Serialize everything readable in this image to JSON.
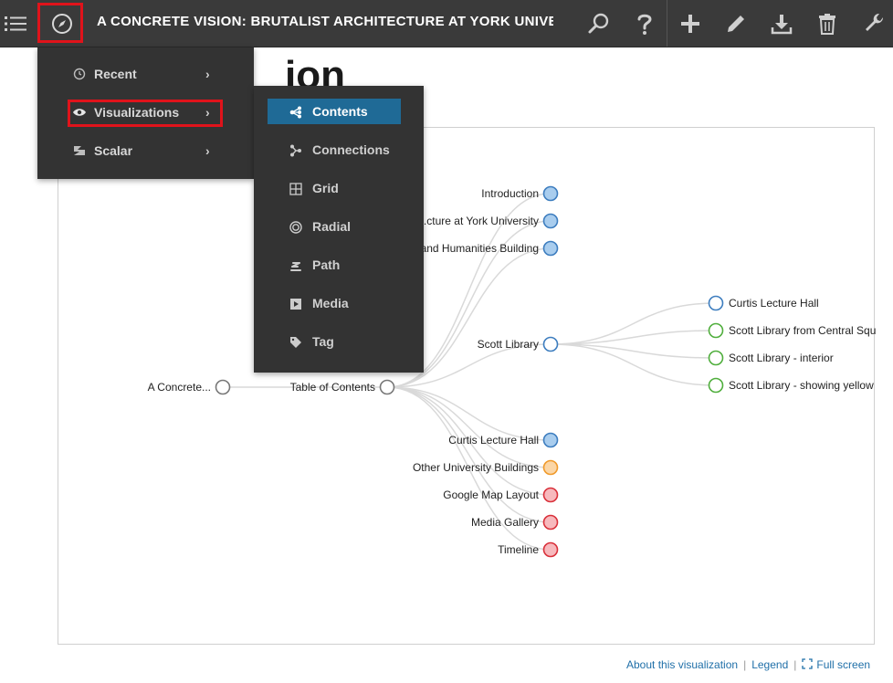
{
  "topbar": {
    "book_title": "A CONCRETE VISION: BRUTALIST ARCHITECTURE AT YORK UNIVERS...",
    "icons": [
      "menu-icon",
      "compass-icon",
      "search-icon",
      "help-icon",
      "plus-icon",
      "pencil-icon",
      "download-icon",
      "trash-icon",
      "wrench-icon"
    ]
  },
  "page": {
    "heading_fragment": "ion"
  },
  "nav_menu": {
    "items": [
      {
        "label": "Recent",
        "icon": "clock-icon"
      },
      {
        "label": "Visualizations",
        "icon": "eye-icon"
      },
      {
        "label": "Scalar",
        "icon": "scalar-icon"
      }
    ],
    "chevron": "›"
  },
  "viz_menu": {
    "items": [
      {
        "label": "Contents",
        "icon": "share-tree-icon",
        "active": true
      },
      {
        "label": "Connections",
        "icon": "connections-icon"
      },
      {
        "label": "Grid",
        "icon": "grid-icon"
      },
      {
        "label": "Radial",
        "icon": "radial-icon"
      },
      {
        "label": "Path",
        "icon": "path-icon"
      },
      {
        "label": "Media",
        "icon": "media-icon"
      },
      {
        "label": "Tag",
        "icon": "tag-icon"
      }
    ]
  },
  "tree": {
    "root": "A Concrete...",
    "toc": "Table of Contents",
    "children": [
      {
        "label": "Introduction",
        "type": "page"
      },
      {
        "label": "...cture at York University",
        "type": "page"
      },
      {
        "label": "...and Humanities Building",
        "type": "page"
      },
      {
        "label": "Scott Library",
        "type": "open"
      },
      {
        "label": "Curtis Lecture Hall",
        "type": "page"
      },
      {
        "label": "Other University Buildings",
        "type": "path"
      },
      {
        "label": "Google Map Layout",
        "type": "media"
      },
      {
        "label": "Media Gallery",
        "type": "media"
      },
      {
        "label": "Timeline",
        "type": "media"
      }
    ],
    "scott_children": [
      {
        "label": "Curtis Lecture Hall",
        "type": "open-blue"
      },
      {
        "label": "Scott Library from Central Squ",
        "type": "open-green"
      },
      {
        "label": "Scott Library - interior",
        "type": "open-green"
      },
      {
        "label": "Scott Library - showing yellow",
        "type": "open-green"
      }
    ]
  },
  "colors": {
    "page_fill": "#a9cdee",
    "page_stroke": "#3d7dbf",
    "path_fill": "#fbd6a6",
    "path_stroke": "#f09a2a",
    "media_fill": "#f7b9bd",
    "media_stroke": "#d9303a",
    "green_stroke": "#4fae3c",
    "open_stroke": "#777777",
    "active_menu": "#1f6a96",
    "highlight": "#e0131b"
  },
  "footer": {
    "about": "About this visualization",
    "legend": "Legend",
    "fullscreen": "Full screen"
  }
}
